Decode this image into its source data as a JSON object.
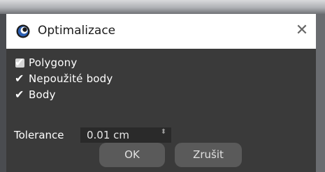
{
  "dialog": {
    "title": "Optimalizace",
    "close_glyph": "✕",
    "app_icon": "cinema4d-logo-icon"
  },
  "options": [
    {
      "label": "Polygony",
      "checked": true
    },
    {
      "label": "Nepoužité body",
      "checked": true
    },
    {
      "label": "Body",
      "checked": true
    }
  ],
  "tolerance": {
    "label": "Tolerance",
    "value": "0.01 cm",
    "spinner_glyph": "⬍"
  },
  "buttons": {
    "ok": "OK",
    "cancel": "Zrušit"
  },
  "colors": {
    "dialog_bg": "#3a3a3a",
    "titlebar_bg": "#ffffff",
    "button_bg": "#5a5a5a",
    "input_bg": "#2a2a2a"
  }
}
